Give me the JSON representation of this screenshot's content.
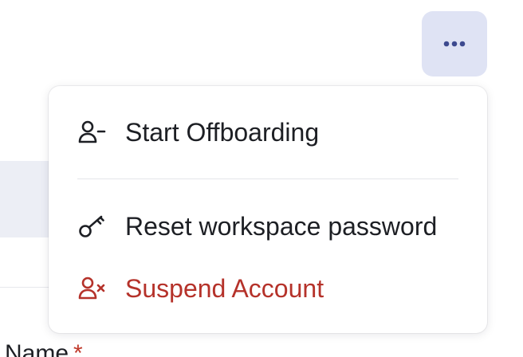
{
  "more_button": {
    "icon": "more-horizontal-icon",
    "color": "#3d4a8f",
    "background": "#dfe3f4"
  },
  "menu": {
    "items": [
      {
        "label": "Start Offboarding",
        "icon": "user-minus-icon",
        "color": "#1d1f24"
      },
      {
        "label": "Reset workspace password",
        "icon": "key-icon",
        "color": "#1d1f24"
      },
      {
        "label": "Suspend Account",
        "icon": "user-x-icon",
        "color": "#b5322a"
      }
    ]
  },
  "form": {
    "name_label": "Name",
    "required_marker": "*"
  },
  "colors": {
    "danger": "#b5322a",
    "accent": "#3d4a8f"
  }
}
